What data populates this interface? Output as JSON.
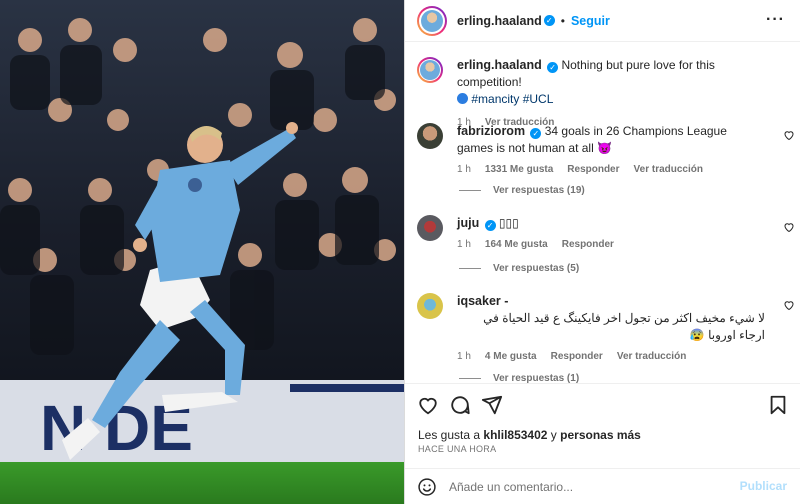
{
  "post": {
    "username": "erling.haaland",
    "follow_label": "Seguir",
    "caption": "Nothing but pure love for this competition!",
    "caption_tags": [
      "#mancity",
      "#UCL"
    ],
    "caption_time": "1 h",
    "caption_translate": "Ver traducción"
  },
  "comments": [
    {
      "user": "fabriziorom",
      "text": "34 goals in 26 Champions League games is not human at all 😈",
      "time": "1 h",
      "likes": "1331 Me gusta",
      "reply": "Responder",
      "translate": "Ver traducción",
      "replies": "Ver respuestas (19)"
    },
    {
      "user": "juju",
      "text": "▯▯▯",
      "time": "1 h",
      "likes": "164 Me gusta",
      "reply": "Responder",
      "replies": "Ver respuestas (5)"
    },
    {
      "user": "iqsaker -",
      "text": "لا شيء مخيف اكثر من تجول اخر فايكينگ ع قيد الحياة في ارجاء اوروبا 😰",
      "time": "1 h",
      "likes": "4 Me gusta",
      "reply": "Responder",
      "translate": "Ver traducción",
      "replies": "Ver respuestas (1)"
    }
  ],
  "likes_bar": {
    "prefix": "Les gusta a",
    "user": "khlil853402",
    "mid": "y",
    "others": "personas más",
    "time": "HACE UNA HORA"
  },
  "comment_box": {
    "placeholder": "Añade un comentario...",
    "post_label": "Publicar"
  },
  "icons": [
    "verified-icon",
    "more-options-icon",
    "heart-icon",
    "comment-icon",
    "share-icon",
    "bookmark-icon",
    "emoji-icon"
  ],
  "colors": {
    "accent": "#0095f6",
    "link": "#00376b",
    "muted": "#737373",
    "kit": "#6cabdd"
  }
}
